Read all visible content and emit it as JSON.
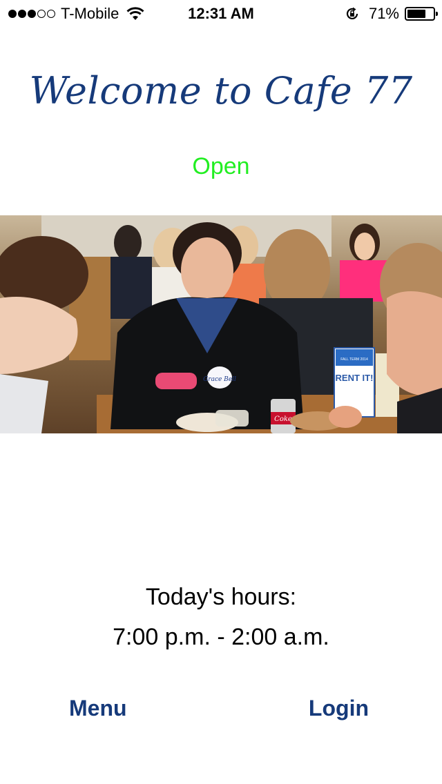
{
  "status_bar": {
    "carrier": "T-Mobile",
    "signal_bars_filled": 3,
    "signal_bars_total": 5,
    "time": "12:31 AM",
    "battery_percent": "71%",
    "battery_level": 0.71
  },
  "header": {
    "title": "Welcome to Cafe 77",
    "status": "Open",
    "status_color": "#22ee22",
    "title_color": "#163a7a"
  },
  "photo": {
    "sign_heading": "FALL TERM 2014",
    "sign_text": "RENT IT!",
    "name_tag": "Grace Bell",
    "can_label": "Coke"
  },
  "hours": {
    "label": "Today's hours:",
    "value": "7:00 p.m. - 2:00 a.m."
  },
  "nav": {
    "menu_label": "Menu",
    "login_label": "Login"
  },
  "icons": [
    "signal-dots-icon",
    "wifi-icon",
    "rotation-lock-icon",
    "battery-icon"
  ]
}
